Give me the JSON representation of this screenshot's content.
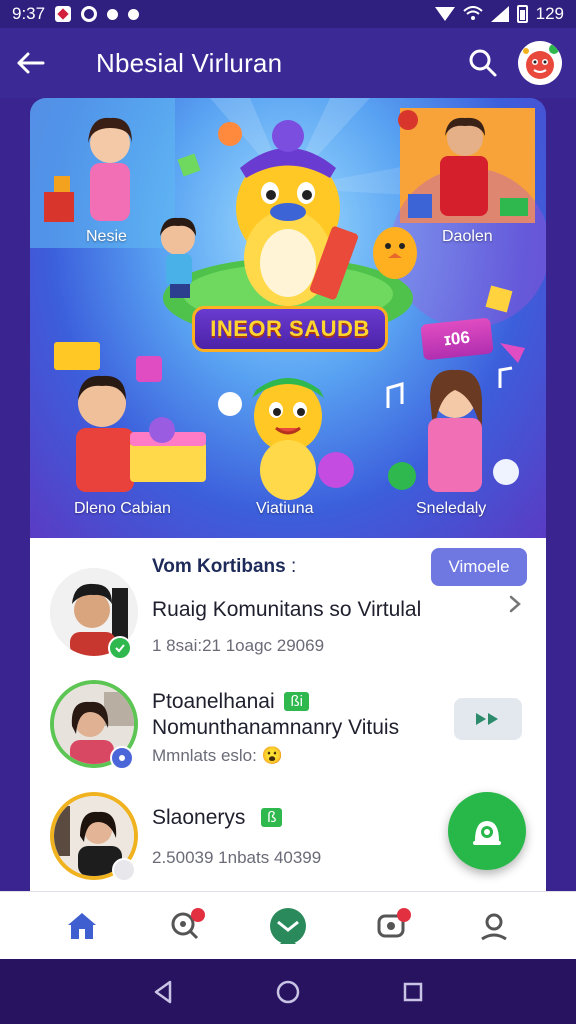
{
  "status_bar": {
    "time": "9:37",
    "battery": "129"
  },
  "app_bar": {
    "title": "Nbesial Virluran"
  },
  "hero": {
    "title_plate": "INEOR SAUDB",
    "badge": "ɪ06",
    "captions": {
      "top_left": "Nesie",
      "top_right": "Daolen",
      "bottom_left": "Dleno Cabian",
      "bottom_center": "Viatiuna",
      "bottom_right": "Sneledaly"
    }
  },
  "section": {
    "header": "Vom Kortibans",
    "header_suffix": ":",
    "button_label": "Vimoele"
  },
  "items": [
    {
      "title": "Ruaig Komunitans so Virtulal",
      "subtitle": "1 8sai:21 1oagc 29069"
    },
    {
      "title_line1": "Ptoanelhanai",
      "tag": "ßi",
      "title_line2": "Nomunthanamnanry Vituis",
      "subtitle": "Mmnlats eslo:",
      "emoji": "😮"
    },
    {
      "title": "Slaonerys",
      "tag": "ß",
      "subtitle": "2.50039 1nbats 40399"
    }
  ],
  "colors": {
    "primary": "#3b2a95",
    "accent": "#6f78e0",
    "green": "#28b84a"
  }
}
